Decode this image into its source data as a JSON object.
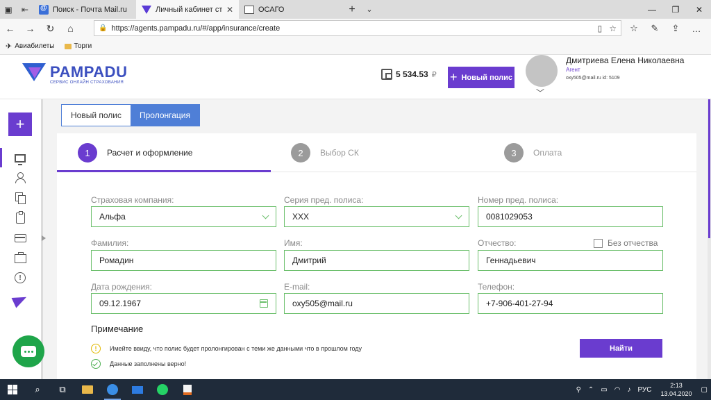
{
  "browser": {
    "tabs": [
      {
        "label": "Поиск - Почта Mail.ru",
        "icon": "mail-icon"
      },
      {
        "label": "Личный кабинет страх",
        "icon": "pampadu-icon"
      },
      {
        "label": "ОСАГО",
        "icon": "page-icon"
      }
    ],
    "url": "https://agents.pampadu.ru/#/app/insurance/create",
    "bookmarks": [
      "Авиабилеты",
      "Торги"
    ]
  },
  "header": {
    "logo_name": "PAMPADU",
    "logo_sub": "СЕРВИС ОНЛАЙН СТРАХОВАНИЯ",
    "balance": "5 534.53",
    "currency": "₽",
    "new_policy": "Новый полис",
    "user_name": "Дмитриева Елена Николаевна",
    "user_role": "Агент",
    "user_meta": "oxy505@mail.ru   id: 5109"
  },
  "mode_tabs": {
    "new": "Новый полис",
    "renew": "Пролонгация"
  },
  "steps": [
    {
      "num": "1",
      "label": "Расчет и оформление"
    },
    {
      "num": "2",
      "label": "Выбор СК"
    },
    {
      "num": "3",
      "label": "Оплата"
    }
  ],
  "form": {
    "company_label": "Страховая компания:",
    "company_value": "Альфа",
    "series_label": "Серия пред. полиса:",
    "series_value": "ХХХ",
    "number_label": "Номер пред. полиса:",
    "number_value": "0081029053",
    "lastname_label": "Фамилия:",
    "lastname_value": "Ромадин",
    "firstname_label": "Имя:",
    "firstname_value": "Дмитрий",
    "patronymic_label": "Отчество:",
    "patronymic_value": "Геннадьевич",
    "no_patronymic": "Без отчества",
    "birth_label": "Дата рождения:",
    "birth_value": "09.12.1967",
    "email_label": "E-mail:",
    "email_value": "oxy505@mail.ru",
    "phone_label": "Телефон:",
    "phone_value": "+7-906-401-27-94"
  },
  "notes": {
    "title": "Примечание",
    "warning": "Имейте ввиду, что полис будет пролонгирован с теми же данными что в прошлом году",
    "ok": "Данные заполнены верно!"
  },
  "find_button": "Найти",
  "taskbar": {
    "lang": "РУС",
    "time": "2:13",
    "date": "13.04.2020"
  }
}
